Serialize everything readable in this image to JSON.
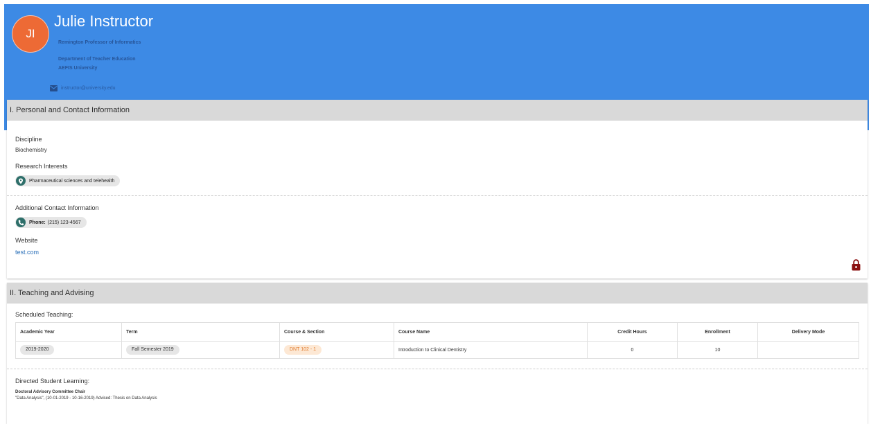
{
  "profile": {
    "initials": "JI",
    "name": "Julie Instructor",
    "title": "Remington Professor of Informatics",
    "department": "Department of Teacher Education",
    "university": "AEFIS University",
    "email": "instructor@university.edu"
  },
  "section1": {
    "title": "I. Personal and Contact Information",
    "discipline_label": "Discipline",
    "discipline_value": "Biochemistry",
    "research_label": "Research Interests",
    "research_chip": "Pharmaceutical sciences and telehealth",
    "contact_label": "Additional Contact Information",
    "phone_label": "Phone:",
    "phone_value": "(215) 123-4567",
    "website_label": "Website",
    "website_value": "test.com"
  },
  "section2": {
    "title": "II. Teaching and Advising",
    "scheduled_label": "Scheduled Teaching:",
    "table": {
      "headers": {
        "academic_year": "Academic Year",
        "term": "Term",
        "course_section": "Course & Section",
        "course_name": "Course Name",
        "credit_hours": "Credit Hours",
        "enrollment": "Enrollment",
        "delivery_mode": "Delivery Mode"
      },
      "rows": [
        {
          "academic_year": "2019-2020",
          "term": "Fall Semester 2019",
          "course_section": "DNT 102 - 1",
          "course_name": "Introduction to Clinical Dentistry",
          "credit_hours": "0",
          "enrollment": "10",
          "delivery_mode": ""
        }
      ]
    },
    "directed_label": "Directed Student Learning:",
    "directed_role": "Doctoral Advisory Committee Chair",
    "directed_detail": "\"Data Analysis\", (10-01-2019 - 10-16-2019) Advised: Thesis on Data Analysis"
  },
  "colors": {
    "header_bg": "#3d8ae5",
    "avatar_bg": "#ed6a35",
    "chip_icon": "#2e6f6a",
    "lock": "#8b1010",
    "link": "#2a6fb8",
    "course_chip_bg": "#fde8d4",
    "course_chip_text": "#e07b2e"
  },
  "icons": {
    "email": "envelope-icon",
    "research": "location-pin-icon",
    "phone": "phone-icon",
    "lock": "lock-icon"
  }
}
